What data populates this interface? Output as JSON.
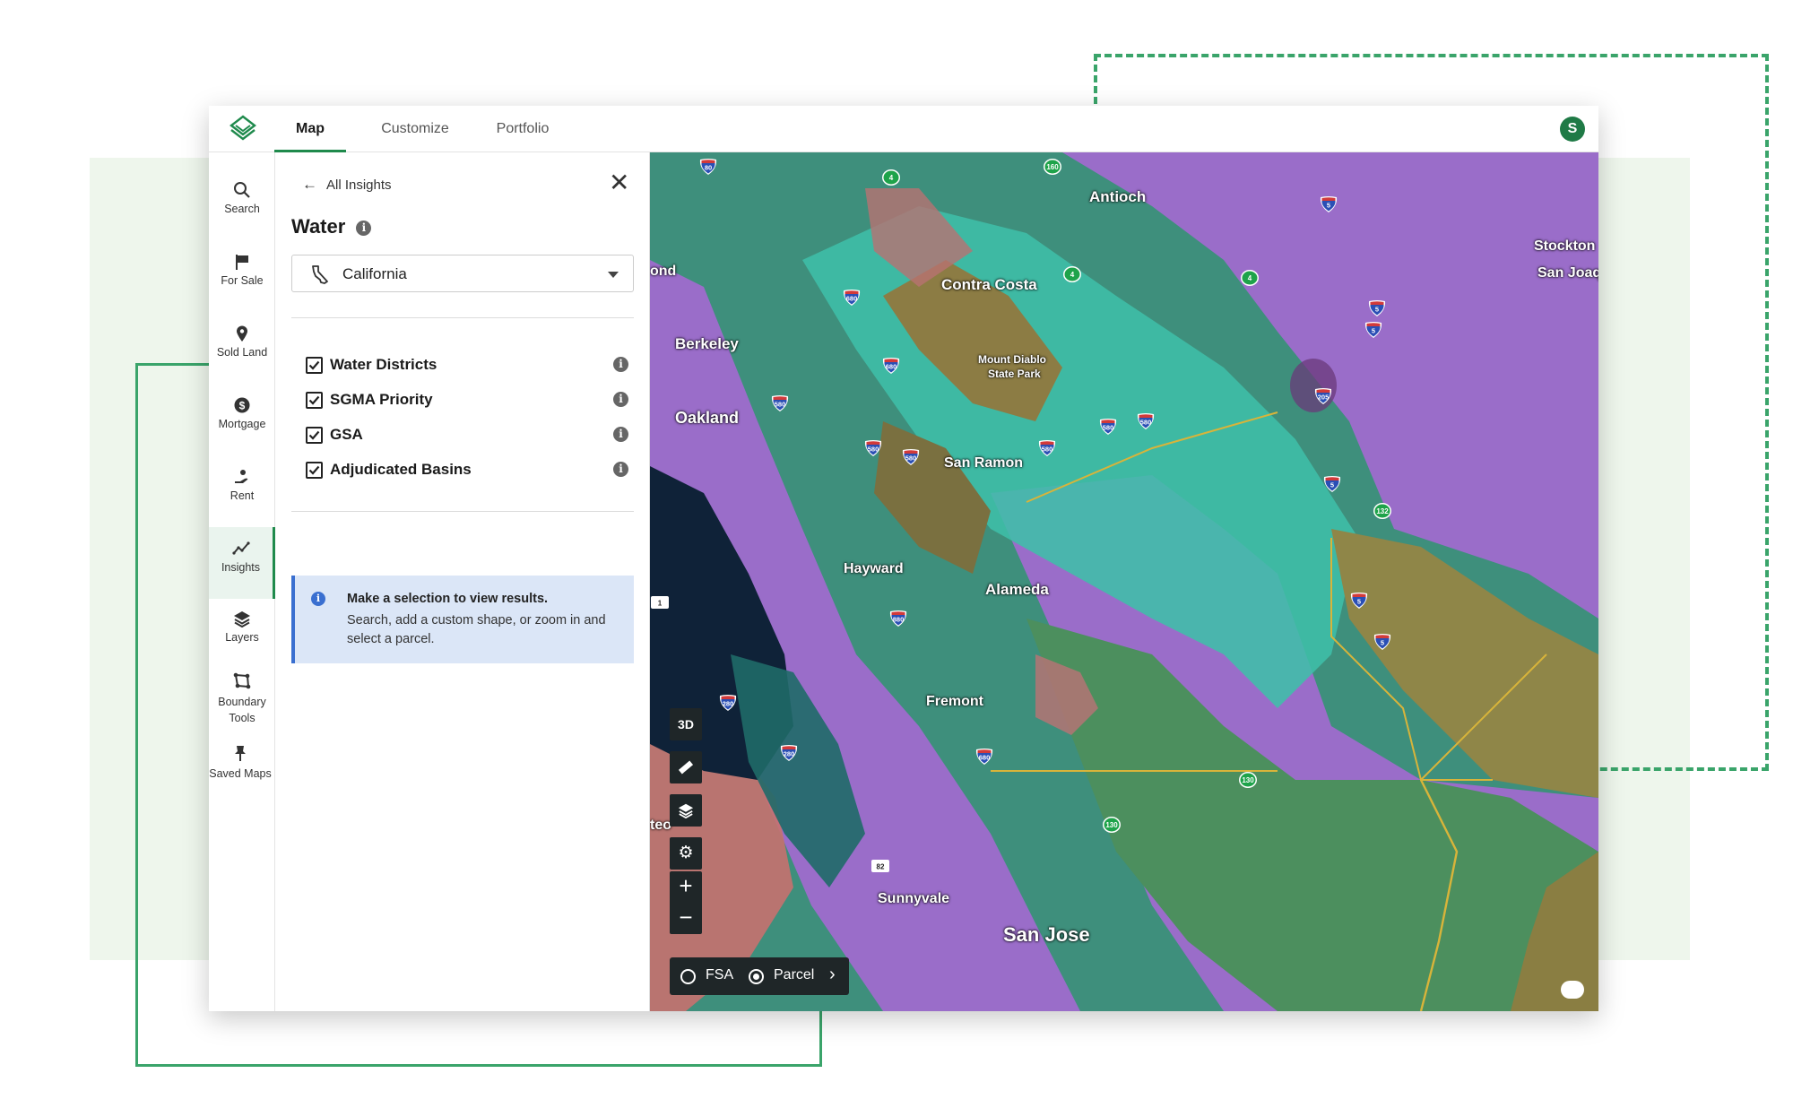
{
  "nav": {
    "tabs": [
      {
        "label": "Map",
        "active": true
      },
      {
        "label": "Customize",
        "active": false
      },
      {
        "label": "Portfolio",
        "active": false
      }
    ],
    "avatar_initial": "S",
    "accent_color": "#1f8a4c"
  },
  "sidebar": {
    "items": [
      {
        "label": "Search",
        "icon": "search-icon"
      },
      {
        "label": "For Sale",
        "icon": "flag-icon"
      },
      {
        "label": "Sold Land",
        "icon": "map-pin-icon"
      },
      {
        "label": "Mortgage",
        "icon": "dollar-icon"
      },
      {
        "label": "Rent",
        "icon": "hand-icon"
      },
      {
        "label": "Insights",
        "icon": "insights-icon",
        "active": true
      },
      {
        "label": "Layers",
        "icon": "layers-icon"
      },
      {
        "label": "Boundary Tools",
        "icon": "boundary-icon"
      },
      {
        "label": "Saved Maps",
        "icon": "pin-icon"
      }
    ]
  },
  "panel": {
    "back_label": "All Insights",
    "title": "Water",
    "state_select": {
      "value": "California",
      "icon": "california-icon"
    },
    "checkboxes": [
      {
        "label": "Water Districts",
        "checked": true
      },
      {
        "label": "SGMA Priority",
        "checked": true
      },
      {
        "label": "GSA",
        "checked": true
      },
      {
        "label": "Adjudicated Basins",
        "checked": true
      }
    ],
    "notice": {
      "title": "Make a selection to view results.",
      "body": "Search, add a custom shape, or zoom in and select a parcel.",
      "color": "#3a6fd0"
    }
  },
  "map": {
    "places": [
      "Antioch",
      "Stockton",
      "San Joaq",
      "ond",
      "Contra Costa",
      "Berkeley",
      "Mount Diablo",
      "State Park",
      "Oakland",
      "San Ramon",
      "Hayward",
      "Alameda",
      "Fremont",
      "teo",
      "Sunnyvale",
      "San Jose"
    ],
    "shields": [
      "80",
      "160",
      "4",
      "5",
      "680",
      "4",
      "4",
      "5",
      "5",
      "680",
      "580",
      "580",
      "580",
      "205",
      "580",
      "580",
      "580",
      "5",
      "132",
      "5",
      "880",
      "5",
      "280",
      "280",
      "680",
      "130",
      "130",
      "82",
      "1"
    ],
    "controls": {
      "three_d": "3D"
    },
    "mode": {
      "options": [
        "FSA",
        "Parcel"
      ],
      "selected": "Parcel"
    },
    "zone_colors": {
      "purple": "#a06ad0",
      "teal": "#3fc6b0",
      "green": "#3e8a5a",
      "gold": "#a38c45",
      "salmon": "#c87070"
    }
  }
}
